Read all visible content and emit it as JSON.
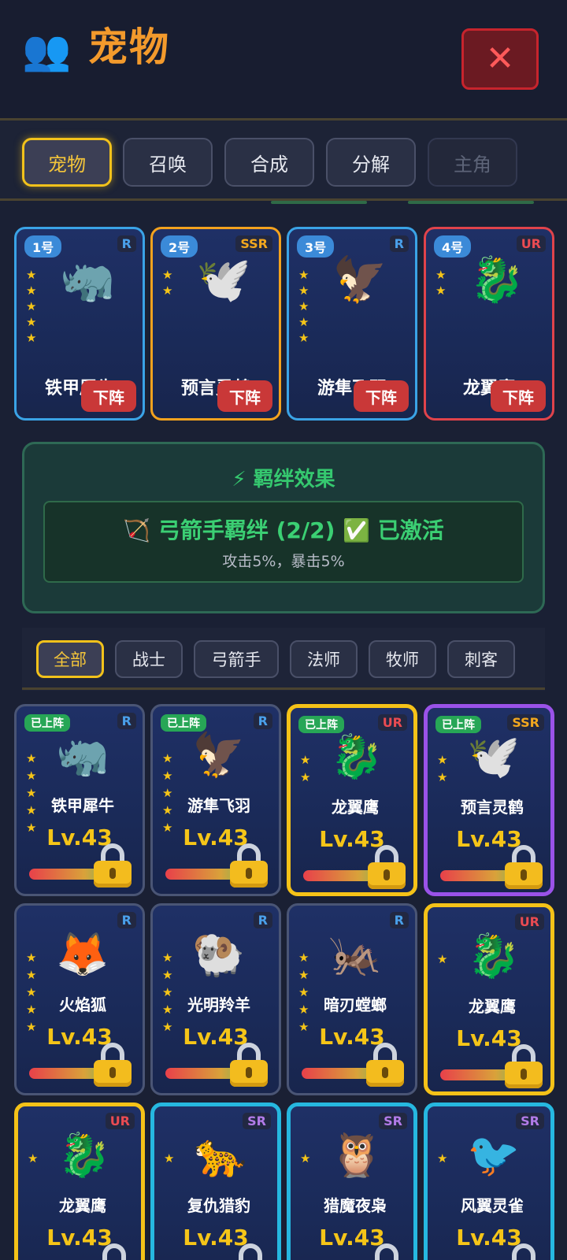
{
  "header": {
    "icon": "people-icon",
    "icon_glyph": "👥",
    "title": "宠物",
    "close_glyph": "✕"
  },
  "tabs": [
    {
      "label": "宠物",
      "state": "active"
    },
    {
      "label": "召唤",
      "state": "normal"
    },
    {
      "label": "合成",
      "state": "normal"
    },
    {
      "label": "分解",
      "state": "normal"
    },
    {
      "label": "主角",
      "state": "disabled"
    }
  ],
  "team": [
    {
      "num": "1号",
      "rarity": "R",
      "emoji": "🦏",
      "stars": 5,
      "name": "铁甲犀牛",
      "action": "下阵"
    },
    {
      "num": "2号",
      "rarity": "SSR",
      "emoji": "🕊️",
      "stars": 2,
      "name": "预言灵鹤",
      "action": "下阵"
    },
    {
      "num": "3号",
      "rarity": "R",
      "emoji": "🦅",
      "stars": 5,
      "name": "游隼飞羽",
      "action": "下阵"
    },
    {
      "num": "4号",
      "rarity": "UR",
      "emoji": "🐉",
      "stars": 2,
      "name": "龙翼鹰",
      "action": "下阵"
    }
  ],
  "bond": {
    "icon": "lightning-icon",
    "title": "⚡ 羁绊效果",
    "name": "🏹 弓箭手羁绊 (2/2) ✅ 已激活",
    "desc": "攻击5%，暴击5%"
  },
  "filters": [
    "全部",
    "战士",
    "弓箭手",
    "法师",
    "牧师",
    "刺客"
  ],
  "active_filter": "全部",
  "pets": [
    {
      "badge": "已上阵",
      "rarity": "R",
      "emoji": "🦏",
      "stars": 5,
      "name": "铁甲犀牛",
      "level": "Lv.43",
      "border": "normal"
    },
    {
      "badge": "已上阵",
      "rarity": "R",
      "emoji": "🦅",
      "stars": 5,
      "name": "游隼飞羽",
      "level": "Lv.43",
      "border": "normal"
    },
    {
      "badge": "已上阵",
      "rarity": "UR",
      "emoji": "🐉",
      "stars": 2,
      "name": "龙翼鹰",
      "level": "Lv.43",
      "border": "gold"
    },
    {
      "badge": "已上阵",
      "rarity": "SSR",
      "emoji": "🕊️",
      "stars": 2,
      "name": "预言灵鹤",
      "level": "Lv.43",
      "border": "purple"
    },
    {
      "badge": "",
      "rarity": "R",
      "emoji": "🦊",
      "stars": 5,
      "name": "火焰狐",
      "level": "Lv.43",
      "border": "normal"
    },
    {
      "badge": "",
      "rarity": "R",
      "emoji": "🐏",
      "stars": 5,
      "name": "光明羚羊",
      "level": "Lv.43",
      "border": "normal"
    },
    {
      "badge": "",
      "rarity": "R",
      "emoji": "🦗",
      "stars": 5,
      "name": "暗刃螳螂",
      "level": "Lv.43",
      "border": "normal"
    },
    {
      "badge": "",
      "rarity": "UR",
      "emoji": "🐉",
      "stars": 1,
      "name": "龙翼鹰",
      "level": "Lv.43",
      "border": "gold"
    },
    {
      "badge": "",
      "rarity": "UR",
      "emoji": "🐉",
      "stars": 1,
      "name": "龙翼鹰",
      "level": "Lv.43",
      "border": "gold"
    },
    {
      "badge": "",
      "rarity": "SR",
      "emoji": "🐆",
      "stars": 1,
      "name": "复仇猎豹",
      "level": "Lv.43",
      "border": "cyan"
    },
    {
      "badge": "",
      "rarity": "SR",
      "emoji": "🦉",
      "stars": 1,
      "name": "猎魔夜枭",
      "level": "Lv.43",
      "border": "cyan"
    },
    {
      "badge": "",
      "rarity": "SR",
      "emoji": "🐦",
      "stars": 1,
      "name": "风翼灵雀",
      "level": "Lv.43",
      "border": "cyan"
    }
  ],
  "colors": {
    "accent_gold": "#f5c218",
    "title_orange": "#f39a2c",
    "bond_green": "#35c86f",
    "close_red": "#c7242d"
  }
}
